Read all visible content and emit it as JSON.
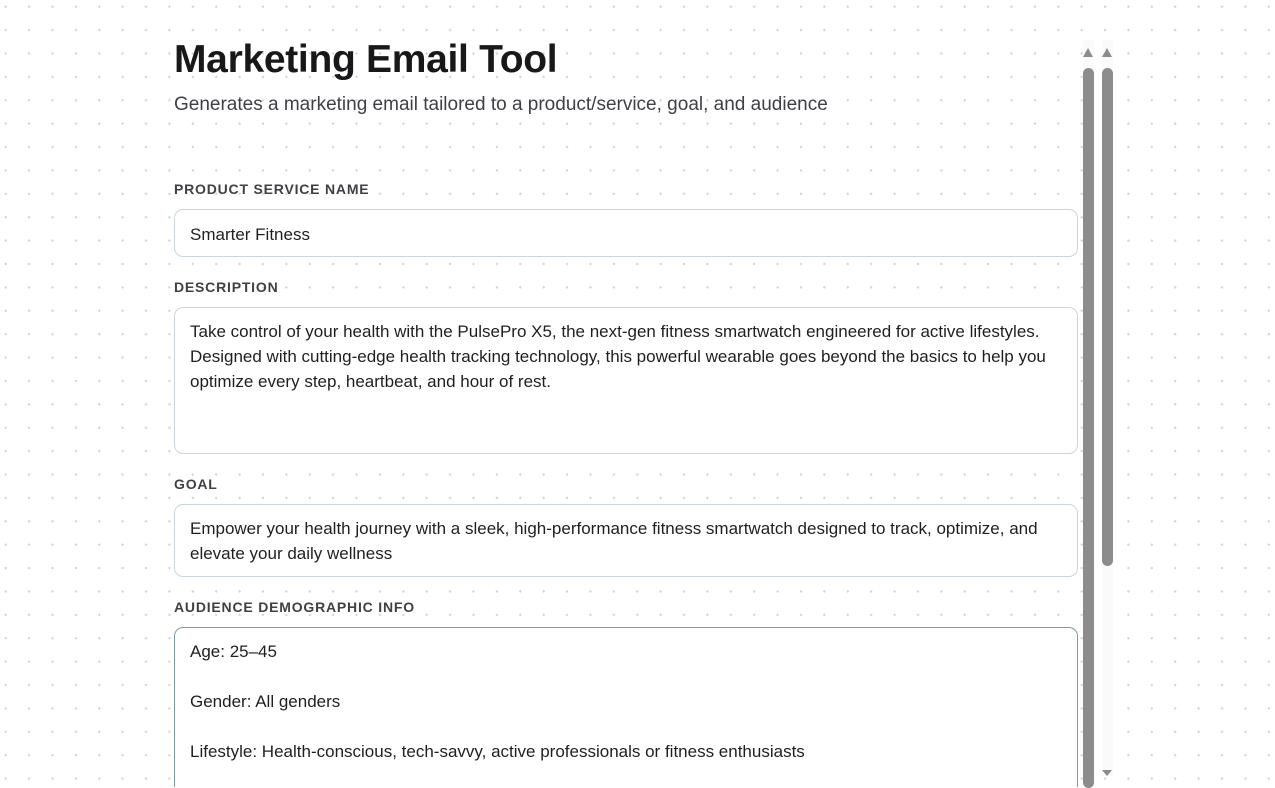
{
  "header": {
    "title": "Marketing Email Tool",
    "subtitle": "Generates a marketing email tailored to a product/service, goal, and audience"
  },
  "fields": [
    {
      "label": "PRODUCT SERVICE NAME",
      "value": "Smarter Fitness"
    },
    {
      "label": "DESCRIPTION",
      "value": "Take control of your health with the PulsePro X5, the next-gen fitness smartwatch engineered for active lifestyles. Designed with cutting-edge health tracking technology, this powerful wearable goes beyond the basics to help you optimize every step, heartbeat, and hour of rest."
    },
    {
      "label": "GOAL",
      "value": "Empower your health journey with a sleek, high-performance fitness smartwatch designed to track, optimize, and elevate your daily wellness"
    },
    {
      "label": "AUDIENCE DEMOGRAPHIC INFO",
      "value": "Age: 25–45\n\nGender: All genders\n\nLifestyle: Health-conscious, tech-savvy, active professionals or fitness enthusiasts"
    }
  ]
}
